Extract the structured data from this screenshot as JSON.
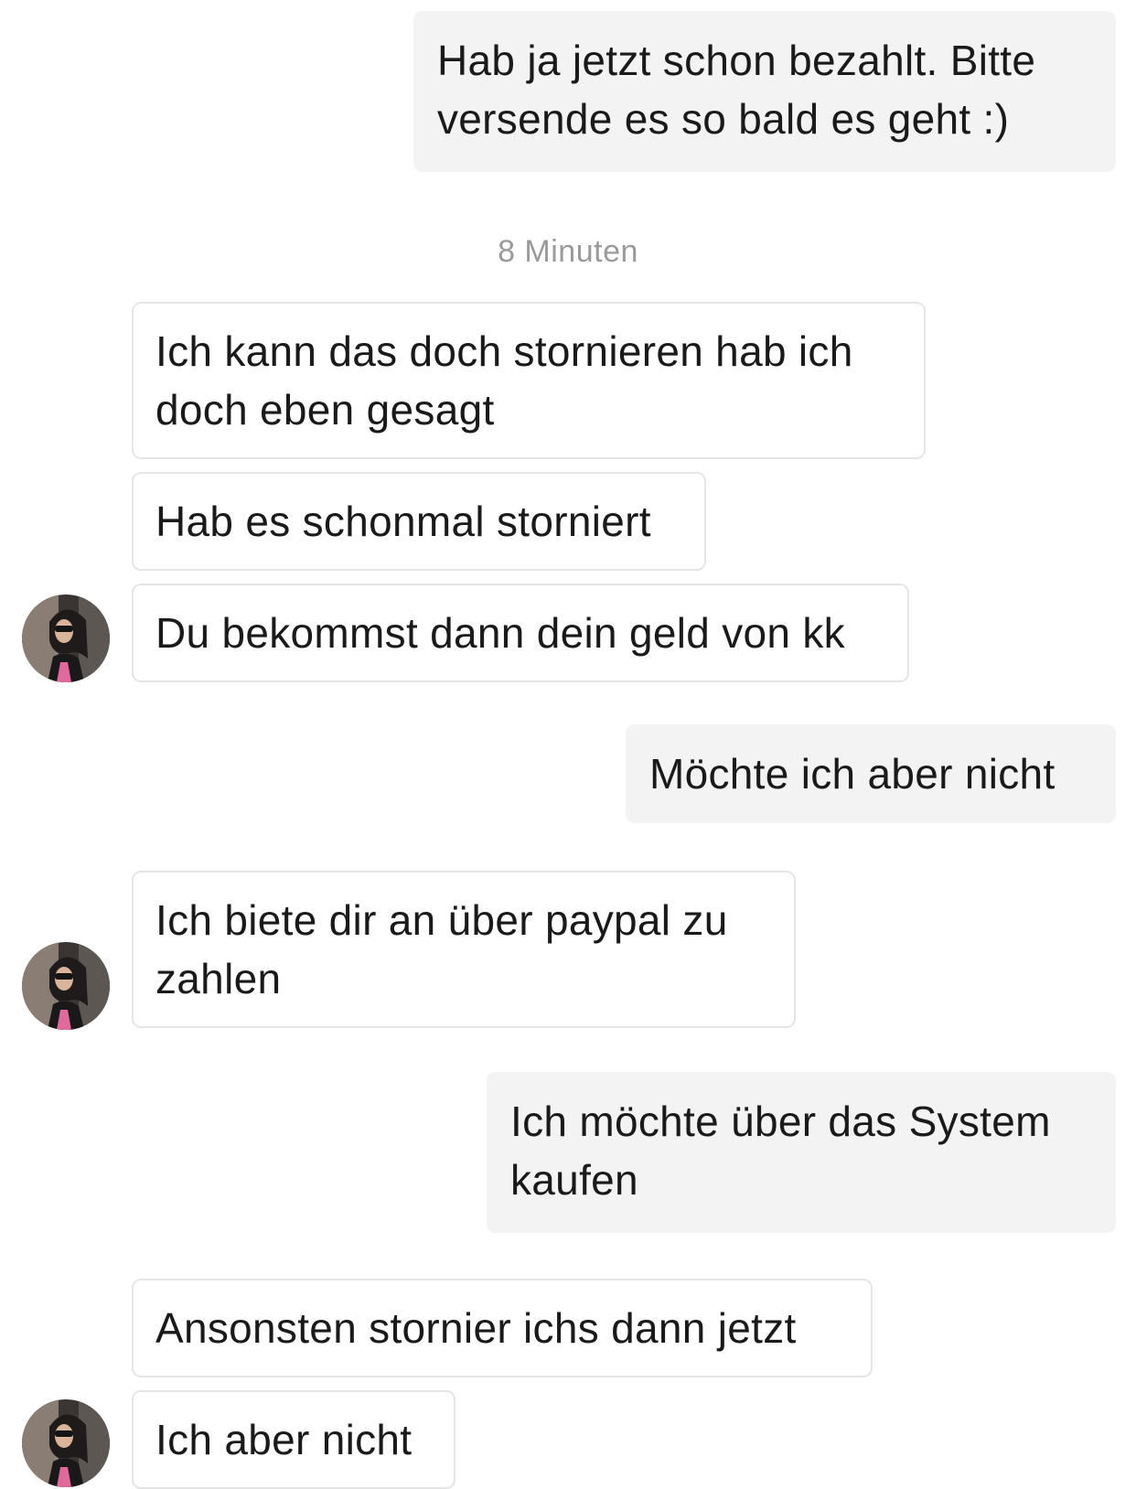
{
  "timestamp": "8 Minuten",
  "messages": [
    {
      "from": "me",
      "text": "Hab ja jetzt schon bezahlt. Bitte versende es so bald es geht :)"
    },
    {
      "from": "partner",
      "text": "Ich kann das doch stornieren hab ich doch eben gesagt"
    },
    {
      "from": "partner",
      "text": "Hab es schonmal storniert"
    },
    {
      "from": "partner",
      "text": "Du bekommst dann dein geld von kk"
    },
    {
      "from": "me",
      "text": "Möchte ich aber nicht"
    },
    {
      "from": "partner",
      "text": "Ich biete dir an über paypal zu zahlen"
    },
    {
      "from": "me",
      "text": "Ich möchte über das System kaufen"
    },
    {
      "from": "partner",
      "text": "Ansonsten stornier ichs dann jetzt"
    },
    {
      "from": "partner",
      "text": "Ich aber nicht"
    }
  ],
  "colors": {
    "sent_bubble": "#f3f3f3",
    "received_border": "#e6e6e6",
    "timestamp_text": "#9a9a9a"
  }
}
